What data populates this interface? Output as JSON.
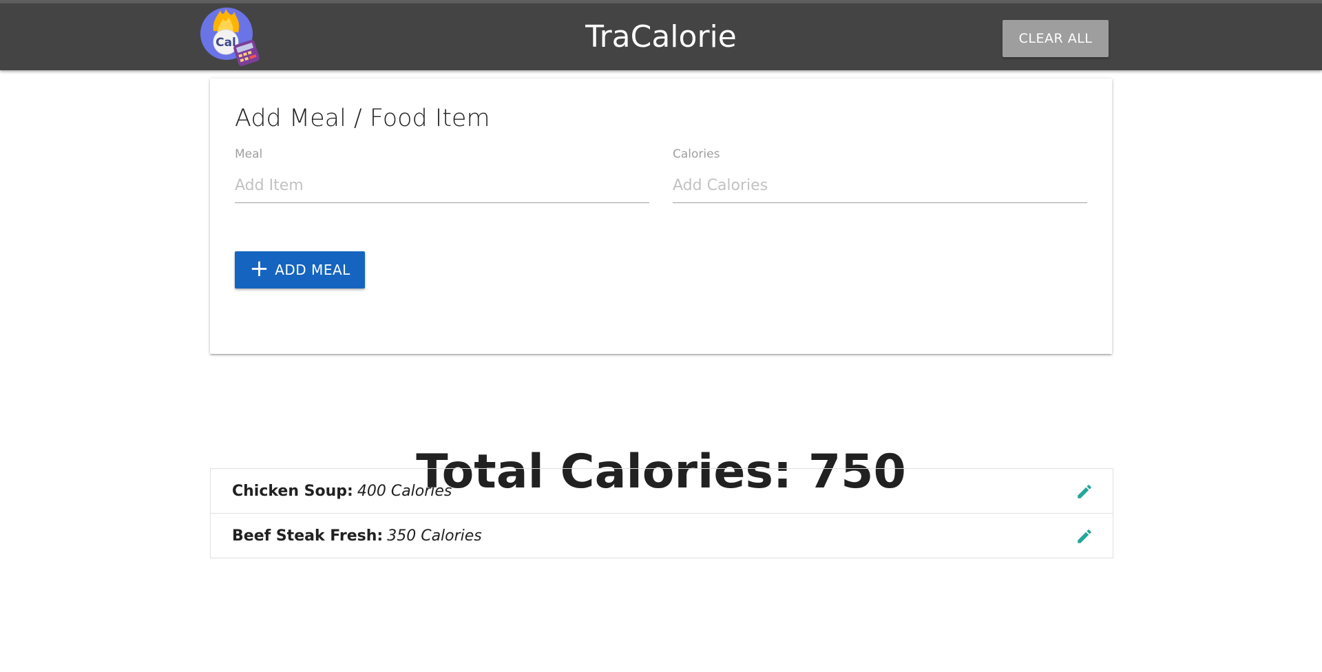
{
  "header": {
    "title": "TraCalorie",
    "logo_text": "Cal",
    "clear_all_label": "CLEAR ALL",
    "bar_color": "#444444"
  },
  "form": {
    "title": "Add Meal / Food Item",
    "meal_label": "Meal",
    "meal_placeholder": "Add Item",
    "meal_value": "",
    "calories_label": "Calories",
    "calories_placeholder": "Add Calories",
    "calories_value": "",
    "add_button_label": "ADD MEAL",
    "add_button_color": "#1565c0"
  },
  "summary": {
    "total_label": "Total Calories:",
    "total_value": "750"
  },
  "items": [
    {
      "name": "Chicken Soup:",
      "calories": "400 Calories"
    },
    {
      "name": "Beef Steak Fresh:",
      "calories": "350 Calories"
    }
  ],
  "icons": {
    "logo": "calorie-calculator-logo",
    "add": "plus-icon",
    "edit": "pencil-icon",
    "edit_color": "#26a69a"
  }
}
